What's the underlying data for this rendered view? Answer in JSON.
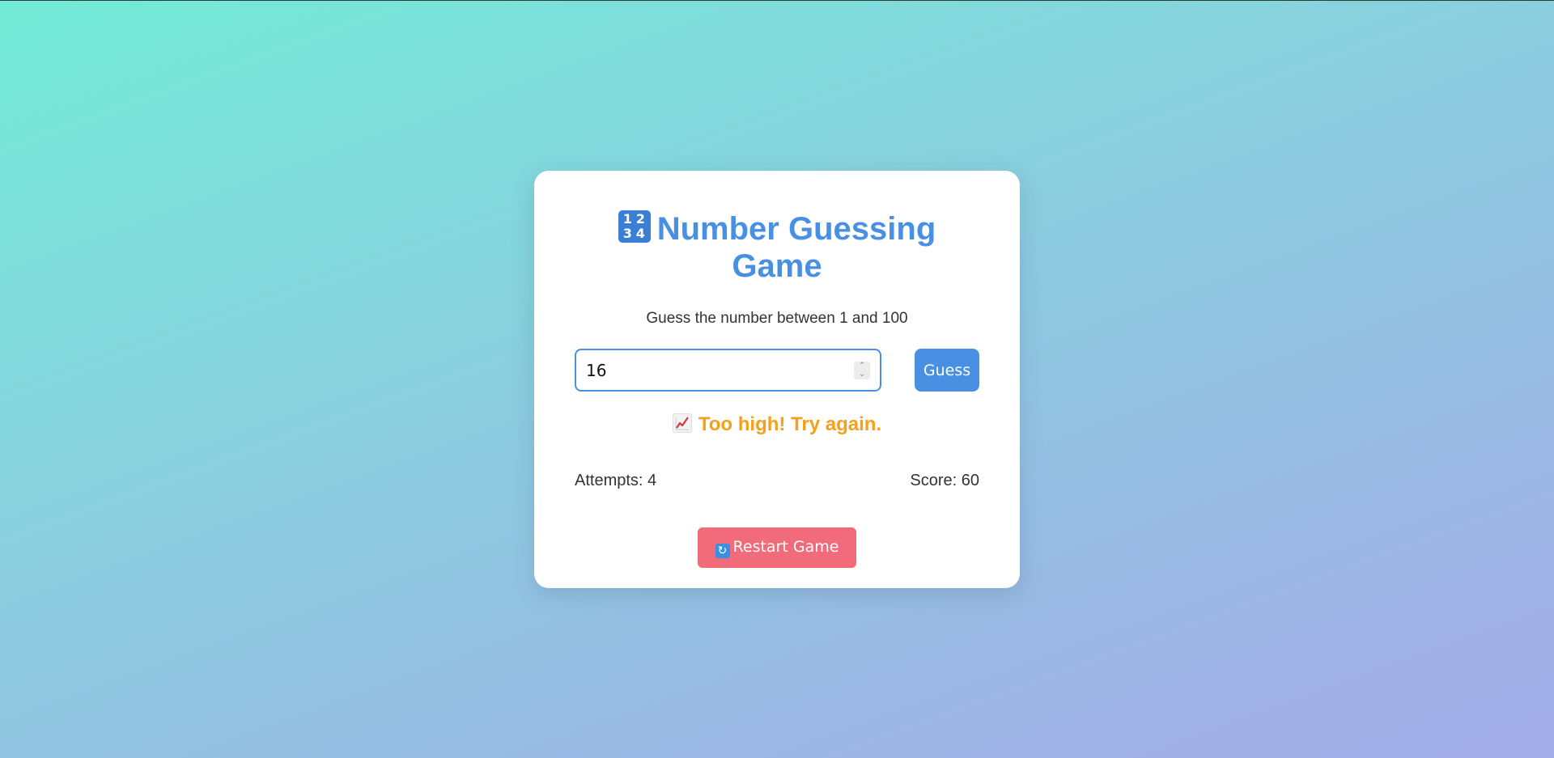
{
  "game": {
    "title": "Number Guessing Game",
    "title_icon": "input-numbers-icon",
    "title_icon_digits": [
      "1",
      "2",
      "3",
      "4"
    ],
    "instructions": "Guess the number between 1 and 100",
    "guess_input": {
      "value": "16",
      "min": "1",
      "max": "100"
    },
    "guess_button_label": "Guess",
    "feedback": {
      "icon": "chart-increasing-icon",
      "text": "Too high! Try again.",
      "color": "#f5a01a"
    },
    "stats": {
      "attempts_label": "Attempts: 4",
      "score_label": "Score: 60"
    },
    "restart_button": {
      "icon": "counterclockwise-arrows-icon",
      "label": "Restart Game",
      "color": "#f26b7a"
    },
    "accent_color": "#4a90e2"
  }
}
